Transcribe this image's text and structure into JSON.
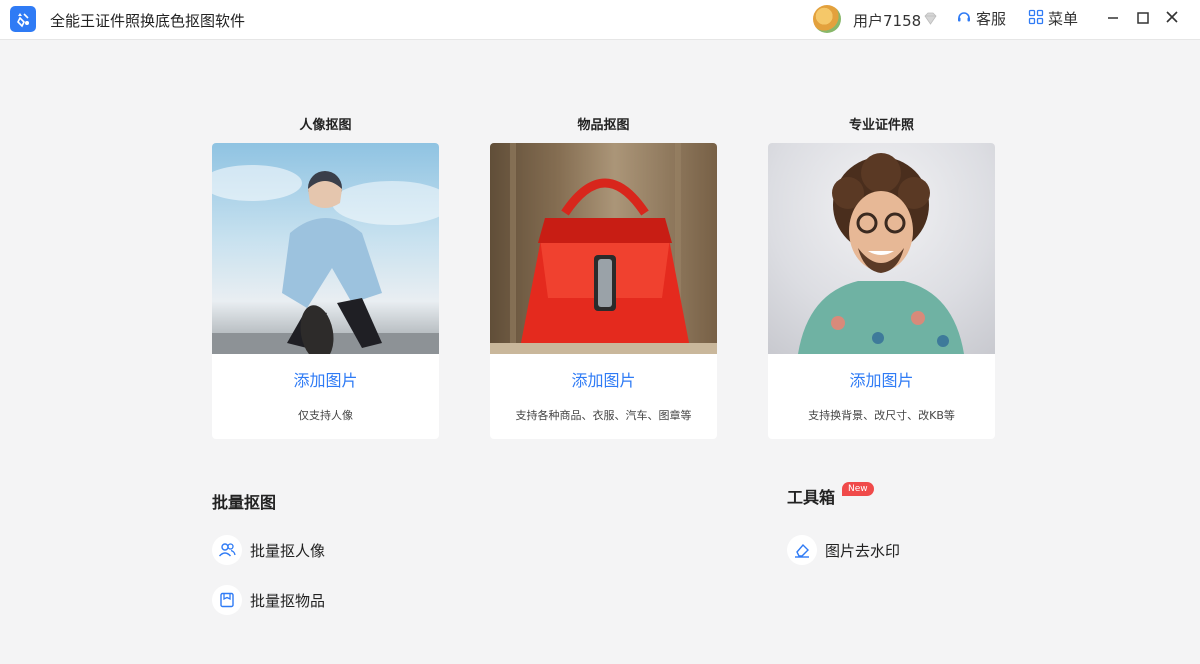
{
  "app": {
    "title": "全能王证件照换底色抠图软件"
  },
  "header": {
    "username": "用户7158",
    "service_label": "客服",
    "menu_label": "菜单"
  },
  "cards": [
    {
      "title": "人像抠图",
      "add_label": "添加图片",
      "desc": "仅支持人像"
    },
    {
      "title": "物品抠图",
      "add_label": "添加图片",
      "desc": "支持各种商品、衣服、汽车、图章等"
    },
    {
      "title": "专业证件照",
      "add_label": "添加图片",
      "desc": "支持换背景、改尺寸、改KB等"
    }
  ],
  "batch": {
    "title": "批量抠图",
    "items": [
      {
        "label": "批量抠人像",
        "icon": "people-icon"
      },
      {
        "label": "批量抠物品",
        "icon": "box-icon"
      }
    ]
  },
  "toolbox": {
    "title": "工具箱",
    "badge": "New",
    "items": [
      {
        "label": "图片去水印",
        "icon": "eraser-icon"
      }
    ]
  },
  "colors": {
    "accent": "#2f7bf5",
    "badge": "#f04a4a",
    "background": "#f4f4f5"
  }
}
